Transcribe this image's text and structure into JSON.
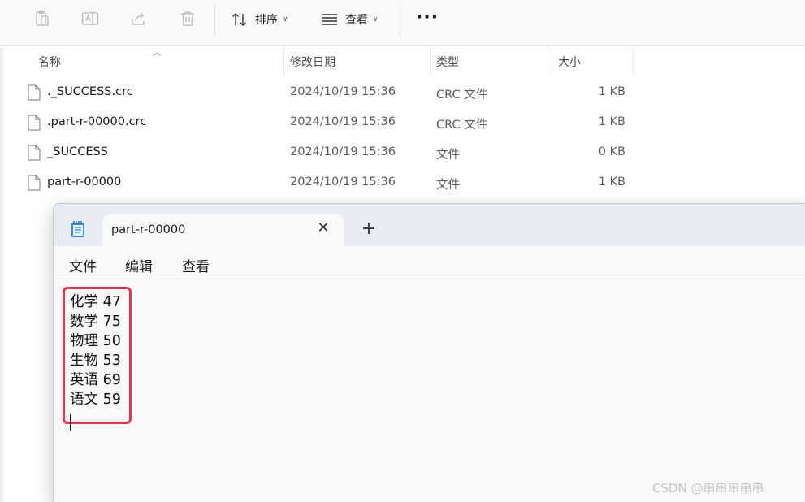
{
  "toolbar": {
    "icons": [
      "paste-icon",
      "rename-icon",
      "share-icon",
      "delete-icon"
    ],
    "sort_label": "排序",
    "view_label": "查看",
    "more_label": "···"
  },
  "columns": [
    {
      "label": "名称"
    },
    {
      "label": "修改日期"
    },
    {
      "label": "类型"
    },
    {
      "label": "大小"
    }
  ],
  "files": [
    {
      "name": "._SUCCESS.crc",
      "date": "2024/10/19 15:36",
      "type": "CRC 文件",
      "size": "1 KB"
    },
    {
      "name": ".part-r-00000.crc",
      "date": "2024/10/19 15:36",
      "type": "CRC 文件",
      "size": "1 KB"
    },
    {
      "name": "_SUCCESS",
      "date": "2024/10/19 15:36",
      "type": "文件",
      "size": "0 KB"
    },
    {
      "name": "part-r-00000",
      "date": "2024/10/19 15:36",
      "type": "文件",
      "size": "1 KB"
    }
  ],
  "notepad": {
    "tab_title": "part-r-00000",
    "close_label": "✕",
    "newtab_label": "+",
    "menu": [
      "文件",
      "编辑",
      "查看"
    ],
    "lines": [
      "化学 47",
      "数学 75",
      "物理 50",
      "生物 53",
      "英语 69",
      "语文 59"
    ],
    "highlight_color": "#e8344a"
  },
  "watermark": "CSDN @串串串串串"
}
